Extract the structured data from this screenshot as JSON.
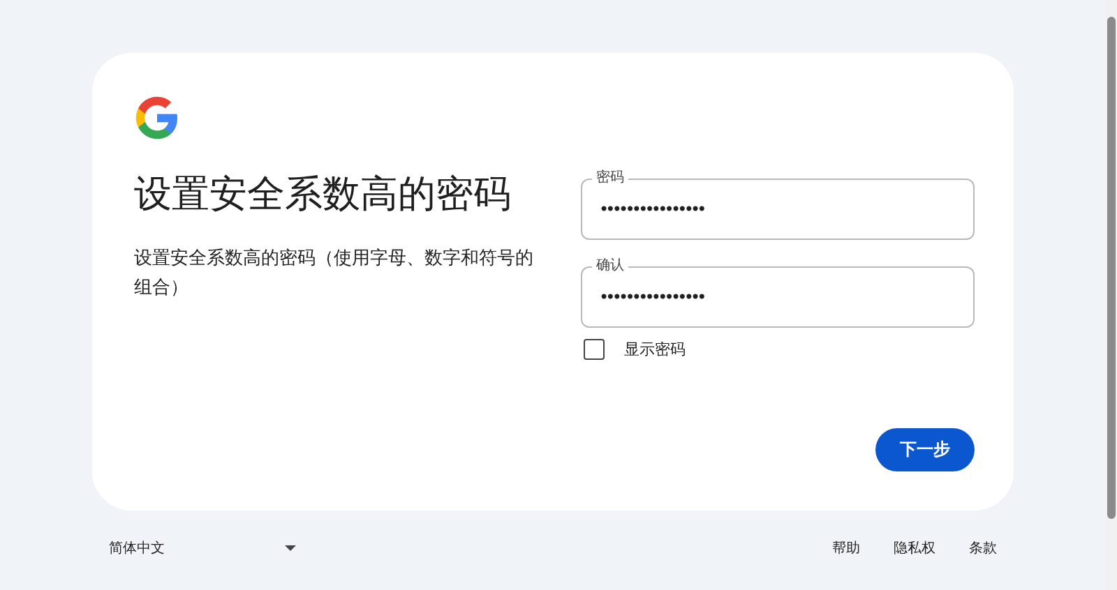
{
  "card": {
    "title": "设置安全系数高的密码",
    "subtitle": "设置安全系数高的密码（使用字母、数字和符号的组合）",
    "fields": [
      {
        "label": "密码",
        "value": "••••••••••••••••"
      },
      {
        "label": "确认",
        "value": "••••••••••••••••"
      }
    ],
    "show_password": {
      "label": "显示密码",
      "checked": false
    },
    "next_button": "下一步"
  },
  "footer": {
    "language": "简体中文",
    "links": [
      "帮助",
      "隐私权",
      "条款"
    ]
  }
}
